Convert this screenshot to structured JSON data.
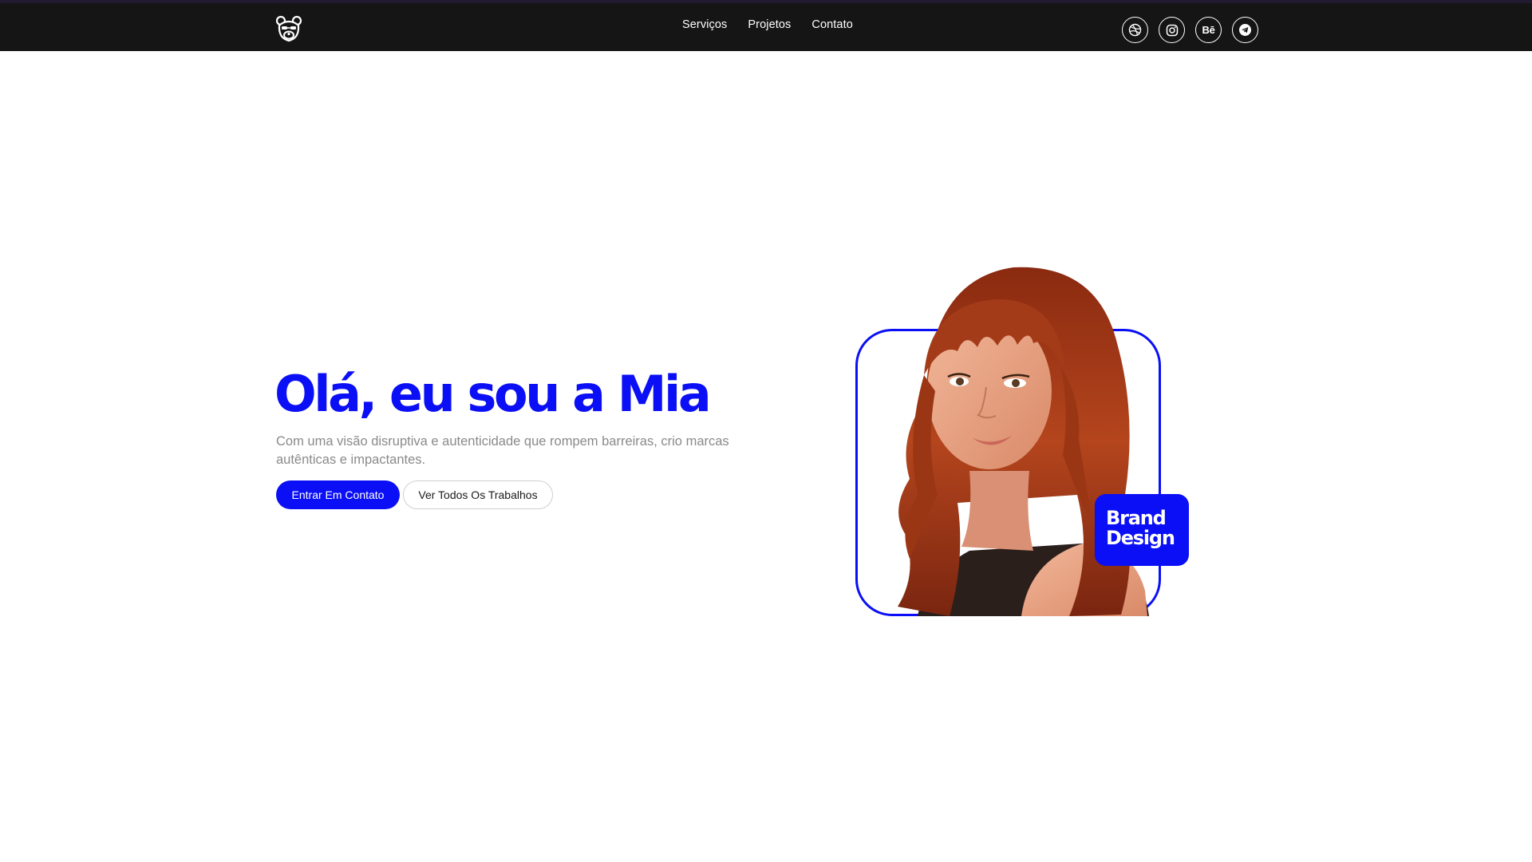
{
  "navbar": {
    "logo_icon": "bear-icon",
    "links": [
      {
        "label": "Serviços"
      },
      {
        "label": "Projetos"
      },
      {
        "label": "Contato"
      }
    ],
    "socials": [
      {
        "icon": "dribbble-icon"
      },
      {
        "icon": "instagram-icon"
      },
      {
        "icon": "behance-icon",
        "text": "Bē"
      },
      {
        "icon": "telegram-icon"
      }
    ]
  },
  "hero": {
    "title": "Olá, eu sou a Mia",
    "text": "Com uma visão disruptiva e autenticidade que rompem barreiras, crio marcas autênticas e impactantes.",
    "primary_button": "Entrar Em Contato",
    "secondary_button": "Ver Todos Os Trabalhos",
    "badge_line1": "Brand",
    "badge_line2": "Design"
  },
  "colors": {
    "accent": "#0a0ff5",
    "navbar_bg": "#151515",
    "body_text": "#8a8a8a"
  }
}
